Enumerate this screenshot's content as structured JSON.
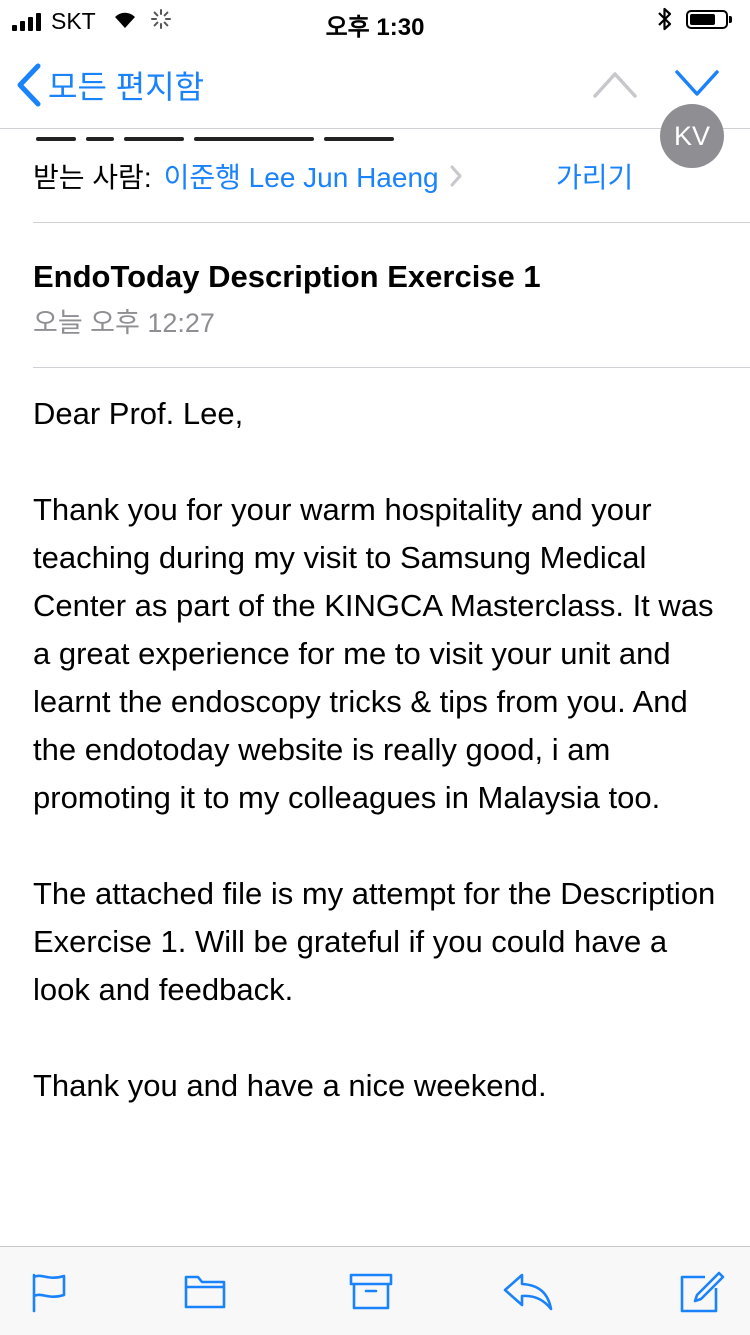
{
  "status_bar": {
    "carrier": "SKT",
    "time": "오후 1:30"
  },
  "nav": {
    "back_label": "모든 편지함",
    "icons": [
      "chevron-left-icon",
      "chevron-up-icon",
      "chevron-down-icon"
    ]
  },
  "header": {
    "avatar_initials": "KV",
    "to_label": "받는 사람:",
    "to_name": "이준행 Lee Jun Haeng",
    "hide_label": "가리기"
  },
  "message": {
    "subject": "EndoToday Description Exercise 1",
    "date": "오늘 오후 12:27",
    "body": [
      "Dear Prof. Lee,",
      "Thank you for your warm hospitality and your teaching during my visit to Samsung Medical Center as part of the KINGCA Masterclass. It was a great experience for me to visit your unit and learnt the endoscopy tricks & tips from you. And the endotoday website is really good,  i am promoting it to my colleagues in Malaysia too.",
      "The attached file is my attempt for the Description Exercise 1. Will be grateful if you could have a look and feedback.",
      "Thank you and have a nice weekend."
    ]
  },
  "toolbar": {
    "icons": [
      "flag-icon",
      "folder-icon",
      "archive-icon",
      "reply-icon",
      "compose-icon"
    ]
  },
  "colors": {
    "accent": "#1a82fb",
    "secondary_text": "#8e8e93",
    "separator": "#d0d0d4"
  }
}
